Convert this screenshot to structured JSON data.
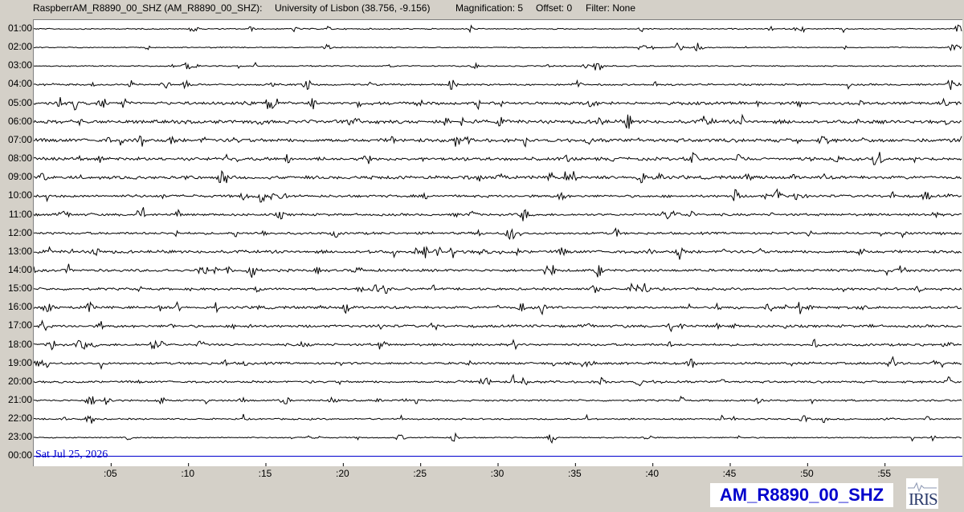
{
  "header": {
    "station_desc": "RaspberrAM_R8890_00_SHZ (AM_R8890_00_SHZ):",
    "location": "University of Lisbon (38.756, -9.156)",
    "magnification": "Magnification: 5",
    "offset": "Offset: 0",
    "filter": "Filter: None"
  },
  "hour_labels": [
    "01:00",
    "02:00",
    "03:00",
    "04:00",
    "05:00",
    "06:00",
    "07:00",
    "08:00",
    "09:00",
    "10:00",
    "11:00",
    "12:00",
    "13:00",
    "14:00",
    "15:00",
    "16:00",
    "17:00",
    "18:00",
    "19:00",
    "20:00",
    "21:00",
    "22:00",
    "23:00",
    "00:00"
  ],
  "minute_labels": [
    ":05",
    ":10",
    ":15",
    ":20",
    ":25",
    ":30",
    ":35",
    ":40",
    ":45",
    ":50",
    ":55"
  ],
  "date_label": "Sat Jul 25, 2026",
  "station_code": "AM_R8890_00_SHZ",
  "logo_text": "IRIS",
  "colors": {
    "trace": "#000000",
    "current_line": "#0000cc",
    "date_text": "#0000cc",
    "background": "#d4d0c8",
    "plot_bg": "#ffffff"
  },
  "trace_noise_levels": [
    0.6,
    0.5,
    0.6,
    0.9,
    1.5,
    1.8,
    1.8,
    1.6,
    1.6,
    1.3,
    1.2,
    1.2,
    1.5,
    1.3,
    1.2,
    1.3,
    1.3,
    1.2,
    1.2,
    1.1,
    0.9,
    0.8,
    0.6
  ]
}
